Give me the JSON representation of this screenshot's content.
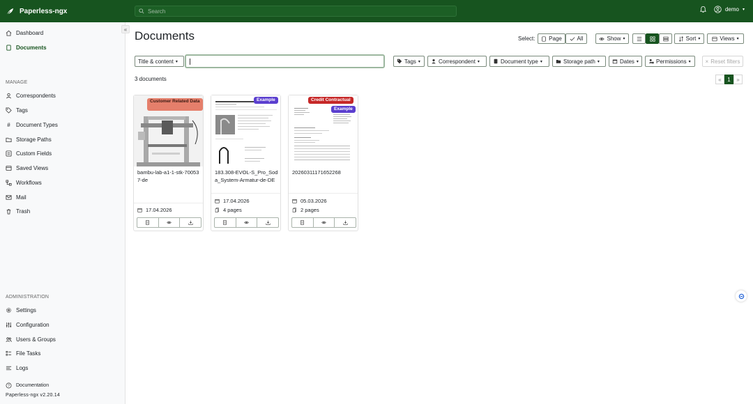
{
  "app": {
    "title": "Paperless-ngx",
    "search_placeholder": "Search",
    "user": "demo"
  },
  "sidebar": {
    "items": [
      {
        "label": "Dashboard",
        "icon": "house-icon"
      },
      {
        "label": "Documents",
        "icon": "file-icon",
        "active": true
      }
    ],
    "manage_heading": "MANAGE",
    "manage_items": [
      {
        "label": "Correspondents",
        "icon": "person-icon"
      },
      {
        "label": "Tags",
        "icon": "tag-icon"
      },
      {
        "label": "Document Types",
        "icon": "hash-icon"
      },
      {
        "label": "Storage Paths",
        "icon": "folder-icon"
      },
      {
        "label": "Custom Fields",
        "icon": "ui-radios-icon"
      },
      {
        "label": "Saved Views",
        "icon": "bookmark-icon"
      },
      {
        "label": "Workflows",
        "icon": "diagram-icon"
      },
      {
        "label": "Mail",
        "icon": "envelope-icon"
      },
      {
        "label": "Trash",
        "icon": "trash-icon"
      }
    ],
    "admin_heading": "ADMINISTRATION",
    "admin_items": [
      {
        "label": "Settings",
        "icon": "gear-icon"
      },
      {
        "label": "Configuration",
        "icon": "sliders-icon"
      },
      {
        "label": "Users & Groups",
        "icon": "people-icon"
      },
      {
        "label": "File Tasks",
        "icon": "list-task-icon"
      },
      {
        "label": "Logs",
        "icon": "text-lines-icon"
      }
    ],
    "documentation": "Documentation",
    "version": "Paperless-ngx v2.20.14"
  },
  "main": {
    "title": "Documents",
    "select_label": "Select:",
    "select_page": "Page",
    "select_all": "All",
    "show": "Show",
    "sort": "Sort",
    "views": "Views",
    "filter_mode": "Title & content",
    "filter_value": "",
    "filters": [
      "Tags",
      "Correspondent",
      "Document type",
      "Storage path",
      "Dates",
      "Permissions"
    ],
    "reset_filters": "Reset filters",
    "doc_count": "3 documents",
    "pager": {
      "prev": "«",
      "current": "1",
      "next": "»"
    }
  },
  "documents": [
    {
      "title": "bambu-lab-a1-1-stk-700537-de",
      "date": "17.04.2026",
      "pages": "",
      "tags": [
        {
          "label": "Customer Related Data",
          "color": "#e57f6b"
        }
      ]
    },
    {
      "title": "183.308-EVOL-S_Pro_Soda_System-Armatur-de-DE",
      "date": "17.04.2026",
      "pages": "4 pages",
      "tags": [
        {
          "label": "Example",
          "color": "#5b3fcf"
        }
      ]
    },
    {
      "title": "20260311171652268",
      "date": "05.03.2026",
      "pages": "2 pages",
      "tags": [
        {
          "label": "Credit Contractual",
          "color": "#c62828"
        },
        {
          "label": "Example",
          "color": "#5b3fcf"
        }
      ]
    }
  ],
  "colors": {
    "brand": "#17541f",
    "sidebar_bg": "#f8f9fa"
  }
}
